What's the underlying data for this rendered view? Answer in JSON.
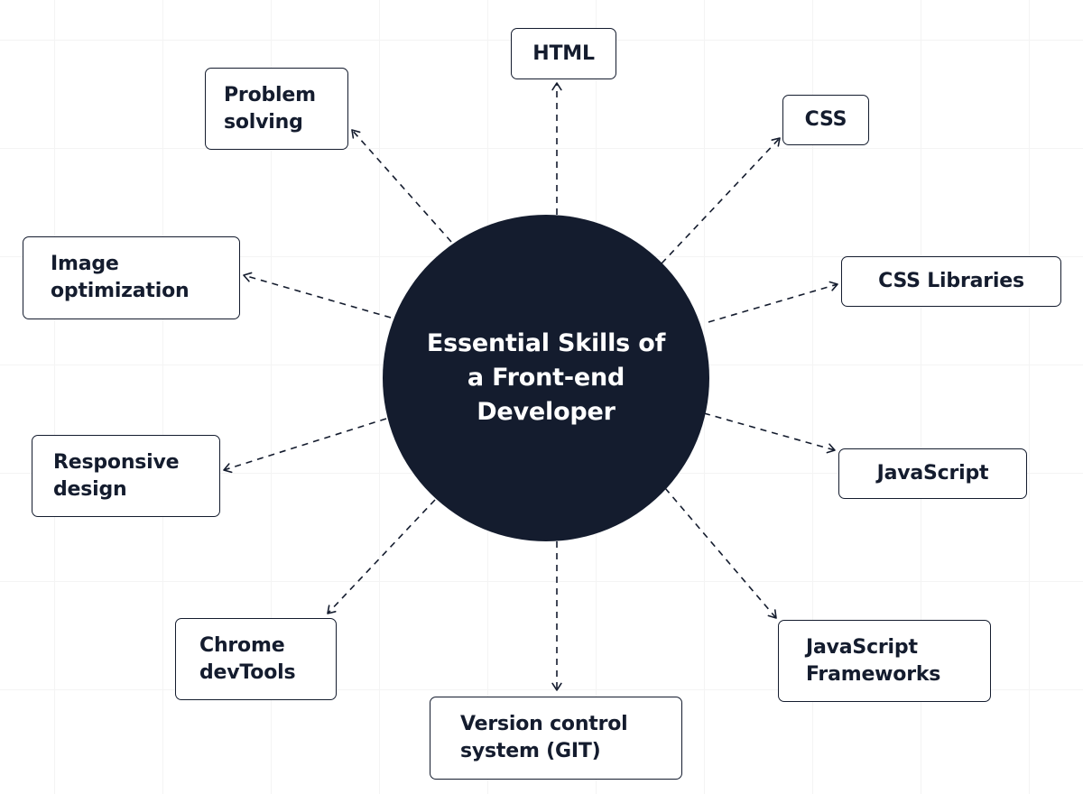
{
  "hub": {
    "title": "Essential Skills of\na Front-end\nDeveloper"
  },
  "skills": [
    {
      "id": "html",
      "label": "HTML"
    },
    {
      "id": "css",
      "label": "CSS"
    },
    {
      "id": "css-libraries",
      "label": "CSS Libraries"
    },
    {
      "id": "javascript",
      "label": "JavaScript"
    },
    {
      "id": "javascript-frameworks",
      "label": "JavaScript\nFrameworks"
    },
    {
      "id": "version-control",
      "label": "Version control\nsystem (GIT)"
    },
    {
      "id": "chrome-devtools",
      "label": "Chrome\ndevTools"
    },
    {
      "id": "responsive-design",
      "label": "Responsive\ndesign"
    },
    {
      "id": "image-optimization",
      "label": "Image\noptimization"
    },
    {
      "id": "problem-solving",
      "label": "Problem\nsolving"
    }
  ],
  "colors": {
    "hub_fill": "#141c2e",
    "ink": "#141c2e",
    "background": "#ffffff"
  }
}
